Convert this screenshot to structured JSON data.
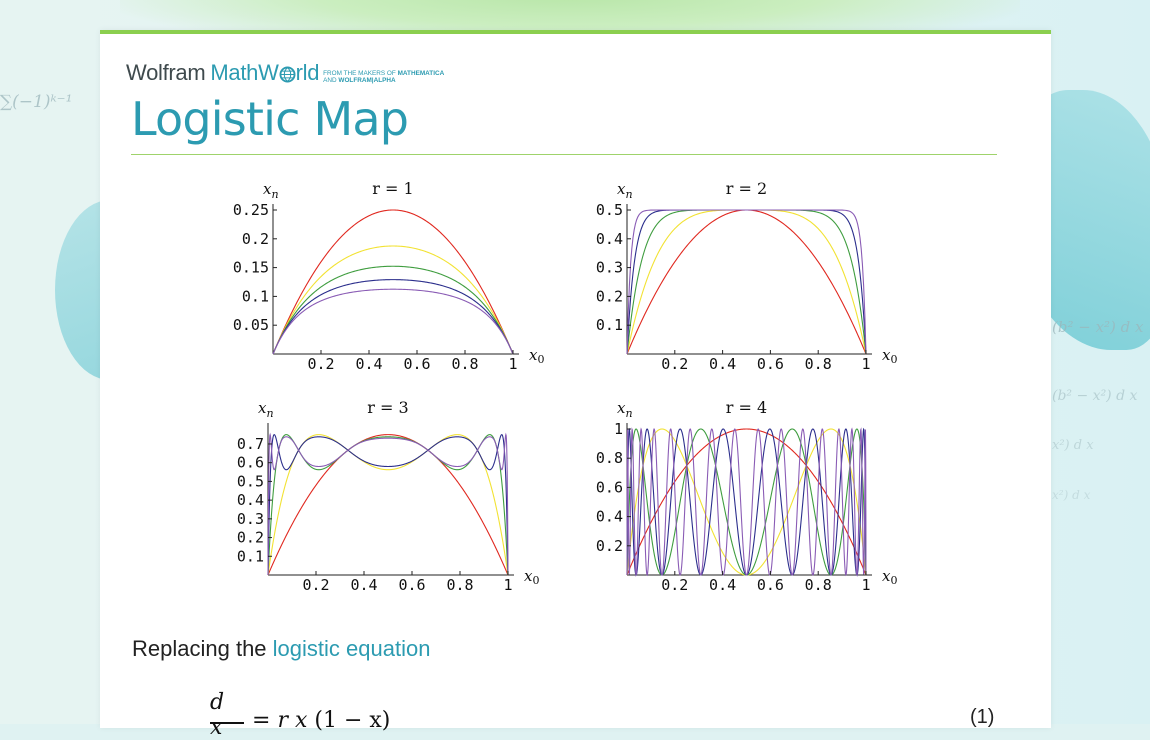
{
  "background": {
    "math_left": "∑(−1)ᵏ⁻¹",
    "math_right_1": "(b² − x²)  d x",
    "math_right_2": "(b² − x²)  d x",
    "math_right_3": "x²)  d x",
    "math_right_4": "x²)  d x"
  },
  "brand": {
    "wolfram": "Wolfram",
    "mathworld_pre": "MathW",
    "mathworld_post": "rld",
    "tagline_line1": "FROM THE MAKERS OF",
    "tagline_bold1": "MATHEMATICA",
    "tagline_line2": "AND",
    "tagline_bold2": "WOLFRAM|ALPHA"
  },
  "page": {
    "title": "Logistic Map"
  },
  "colors": {
    "accent": "#2c9bb1",
    "rule": "#9fd36b",
    "series": [
      "#e0281f",
      "#f2e233",
      "#3f9d3f",
      "#2b2e8c",
      "#8a5cb5"
    ]
  },
  "chart_data": [
    {
      "type": "line",
      "title": "r = 1",
      "ylabel": "x",
      "ylabel_sub": "n",
      "xlabel": "x",
      "xlabel_sub": "0",
      "r": 1,
      "iterations": [
        1,
        2,
        3,
        4,
        5
      ],
      "xlim": [
        0,
        1
      ],
      "ylim": [
        0,
        0.25
      ],
      "xticks": [
        "0.2",
        "0.4",
        "0.6",
        "0.8",
        "1"
      ],
      "yticks": [
        "0.05",
        "0.1",
        "0.15",
        "0.2",
        "0.25"
      ]
    },
    {
      "type": "line",
      "title": "r = 2",
      "ylabel": "x",
      "ylabel_sub": "n",
      "xlabel": "x",
      "xlabel_sub": "0",
      "r": 2,
      "iterations": [
        1,
        2,
        3,
        4,
        5
      ],
      "xlim": [
        0,
        1
      ],
      "ylim": [
        0,
        0.5
      ],
      "xticks": [
        "0.2",
        "0.4",
        "0.6",
        "0.8",
        "1"
      ],
      "yticks": [
        "0.1",
        "0.2",
        "0.3",
        "0.4",
        "0.5"
      ]
    },
    {
      "type": "line",
      "title": "r = 3",
      "ylabel": "x",
      "ylabel_sub": "n",
      "xlabel": "x",
      "xlabel_sub": "0",
      "r": 3,
      "iterations": [
        1,
        2,
        3,
        4,
        5
      ],
      "xlim": [
        0,
        1
      ],
      "ylim": [
        0,
        0.78
      ],
      "xticks": [
        "0.2",
        "0.4",
        "0.6",
        "0.8",
        "1"
      ],
      "yticks": [
        "0.1",
        "0.2",
        "0.3",
        "0.4",
        "0.5",
        "0.6",
        "0.7"
      ]
    },
    {
      "type": "line",
      "title": "r = 4",
      "ylabel": "x",
      "ylabel_sub": "n",
      "xlabel": "x",
      "xlabel_sub": "0",
      "r": 4,
      "iterations": [
        1,
        2,
        3,
        4,
        5
      ],
      "xlim": [
        0,
        1
      ],
      "ylim": [
        0,
        1
      ],
      "xticks": [
        "0.2",
        "0.4",
        "0.6",
        "0.8",
        "1"
      ],
      "yticks": [
        "0.2",
        "0.4",
        "0.6",
        "0.8",
        "1"
      ]
    }
  ],
  "body": {
    "intro_text": "Replacing the ",
    "link_text": "logistic equation"
  },
  "equation": {
    "numerator": "d x",
    "rhs_r": "r",
    "rhs_x": "x",
    "rhs_paren": "(1 − x)",
    "equals": "=",
    "number": "(1)"
  }
}
